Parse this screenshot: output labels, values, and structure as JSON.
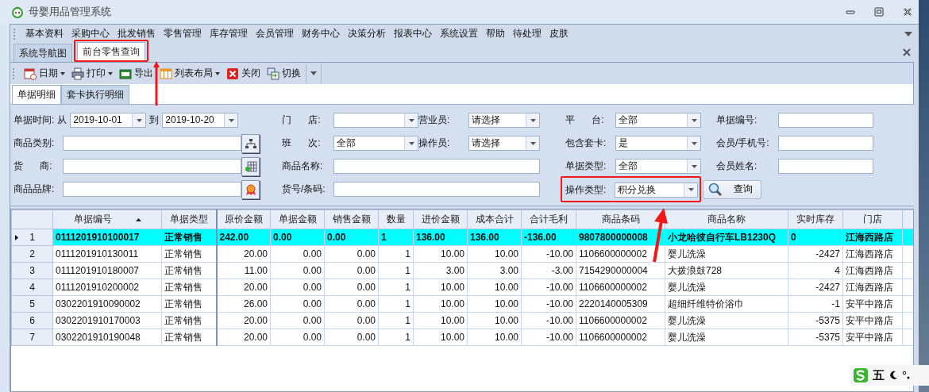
{
  "window": {
    "title": "母婴用品管理系统"
  },
  "menu": [
    "基本资料",
    "采购中心",
    "批发销售",
    "零售管理",
    "库存管理",
    "会员管理",
    "财务中心",
    "决策分析",
    "报表中心",
    "系统设置",
    "帮助",
    "待处理",
    "皮肤"
  ],
  "doc_tabs": [
    {
      "label": "系统导航图",
      "selected": false,
      "highlighted": false
    },
    {
      "label": "前台零售查询",
      "selected": true,
      "highlighted": true
    }
  ],
  "toolbar": [
    {
      "label": "日期",
      "kind": "calendar",
      "dropdown": true
    },
    {
      "label": "打印",
      "kind": "print",
      "dropdown": true
    },
    {
      "label": "导出",
      "kind": "excel",
      "dropdown": false
    },
    {
      "label": "列表布局",
      "kind": "columns",
      "dropdown": true
    },
    {
      "label": "关闭",
      "kind": "close",
      "dropdown": false
    },
    {
      "label": "切换",
      "kind": "switch",
      "dropdown": false
    }
  ],
  "sub_tabs": [
    {
      "label": "单据明细",
      "selected": true
    },
    {
      "label": "套卡执行明细",
      "selected": false
    }
  ],
  "filters": {
    "date": {
      "label": "单据时间:",
      "from_label": "从",
      "from": "2019-10-01",
      "to_label": "到",
      "to": "2019-10-20"
    },
    "category": {
      "label": "商品类别:"
    },
    "supplier": {
      "label": "货 商:"
    },
    "brand": {
      "label": "商品品牌:"
    },
    "store": {
      "label": "门 店:"
    },
    "shift": {
      "label": "班 次:",
      "value": "全部"
    },
    "product_name": {
      "label": "商品名称:"
    },
    "sku": {
      "label": "货号/条码:"
    },
    "clerk": {
      "label": "营业员:",
      "value": "请选择"
    },
    "operator": {
      "label": "操作员:",
      "value": "请选择"
    },
    "platform": {
      "label": "平 台:",
      "value": "全部"
    },
    "include_card": {
      "label": "包含套卡:",
      "value": "是"
    },
    "doc_type": {
      "label": "单据类型:",
      "value": "全部"
    },
    "op_type": {
      "label": "操作类型:",
      "value": "积分兑换",
      "highlighted": true
    },
    "doc_no": {
      "label": "单据编号:"
    },
    "member_phone": {
      "label": "会员/手机号:"
    },
    "member_name": {
      "label": "会员姓名:"
    },
    "query_button": "查询"
  },
  "table": {
    "columns": [
      {
        "label": "单据编号",
        "kind": "text",
        "sorted": true
      },
      {
        "label": "单据类型",
        "kind": "text",
        "sorted": false
      },
      {
        "label": "原价金额",
        "kind": "number",
        "sorted": false
      },
      {
        "label": "单据金额",
        "kind": "number",
        "sorted": false
      },
      {
        "label": "销售金额",
        "kind": "number",
        "sorted": false
      },
      {
        "label": "数量",
        "kind": "number",
        "sorted": false
      },
      {
        "label": "进价金额",
        "kind": "number",
        "sorted": false
      },
      {
        "label": "成本合计",
        "kind": "number",
        "sorted": false
      },
      {
        "label": "合计毛利",
        "kind": "number",
        "sorted": false
      },
      {
        "label": "商品条码",
        "kind": "text",
        "sorted": false
      },
      {
        "label": "商品名称",
        "kind": "text",
        "sorted": false
      },
      {
        "label": "实时库存",
        "kind": "number",
        "sorted": false
      },
      {
        "label": "门店",
        "kind": "text",
        "sorted": false
      }
    ],
    "rows": [
      {
        "num": "1",
        "selected": true,
        "cells": [
          "0111201910100017",
          "正常销售",
          "242.00",
          "0.00",
          "0.00",
          "1",
          "136.00",
          "136.00",
          "-136.00",
          "9807800000008",
          "小龙哈彼自行车LB1230Q",
          "0",
          "江海西路店"
        ]
      },
      {
        "num": "2",
        "selected": false,
        "cells": [
          "0111201910130011",
          "正常销售",
          "20.00",
          "0.00",
          "0.00",
          "1",
          "10.00",
          "10.00",
          "-10.00",
          "1106600000002",
          "婴儿洗澡",
          "-2427",
          "江海西路店"
        ]
      },
      {
        "num": "3",
        "selected": false,
        "cells": [
          "0111201910180007",
          "正常销售",
          "11.00",
          "0.00",
          "0.00",
          "1",
          "3.00",
          "3.00",
          "-3.00",
          "7154290000004",
          "大拨浪鼓728",
          "4",
          "江海西路店"
        ]
      },
      {
        "num": "4",
        "selected": false,
        "cells": [
          "0111201910200002",
          "正常销售",
          "20.00",
          "0.00",
          "0.00",
          "1",
          "10.00",
          "10.00",
          "-10.00",
          "1106600000002",
          "婴儿洗澡",
          "-2427",
          "江海西路店"
        ]
      },
      {
        "num": "5",
        "selected": false,
        "cells": [
          "0302201910090002",
          "正常销售",
          "26.00",
          "0.00",
          "0.00",
          "1",
          "10.00",
          "10.00",
          "-10.00",
          "2220140005309",
          "超细纤维特价浴巾",
          "-1",
          "安平中路店"
        ]
      },
      {
        "num": "6",
        "selected": false,
        "cells": [
          "0302201910170003",
          "正常销售",
          "20.00",
          "0.00",
          "0.00",
          "1",
          "10.00",
          "10.00",
          "-10.00",
          "1106600000002",
          "婴儿洗澡",
          "-5375",
          "安平中路店"
        ]
      },
      {
        "num": "7",
        "selected": false,
        "cells": [
          "0302201910190048",
          "正常销售",
          "20.00",
          "0.00",
          "0.00",
          "1",
          "10.00",
          "10.00",
          "-10.00",
          "1106600000002",
          "婴儿洗澡",
          "-5375",
          "安平中路店"
        ]
      }
    ]
  },
  "ime": {
    "label": "五"
  }
}
